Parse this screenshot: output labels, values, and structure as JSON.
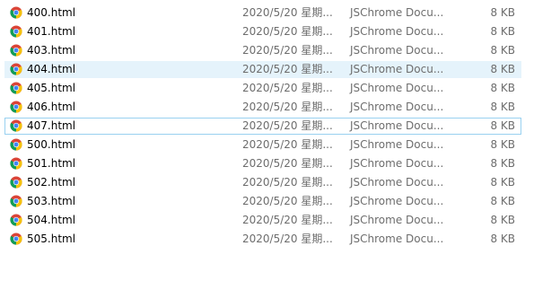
{
  "files": [
    {
      "name": "400.html",
      "date": "2020/5/20 星期...",
      "type": "JSChrome Docu...",
      "size": "8 KB",
      "icon": "chrome-icon"
    },
    {
      "name": "401.html",
      "date": "2020/5/20 星期...",
      "type": "JSChrome Docu...",
      "size": "8 KB",
      "icon": "chrome-icon"
    },
    {
      "name": "403.html",
      "date": "2020/5/20 星期...",
      "type": "JSChrome Docu...",
      "size": "8 KB",
      "icon": "chrome-icon"
    },
    {
      "name": "404.html",
      "date": "2020/5/20 星期...",
      "type": "JSChrome Docu...",
      "size": "8 KB",
      "icon": "chrome-icon",
      "state": "hover"
    },
    {
      "name": "405.html",
      "date": "2020/5/20 星期...",
      "type": "JSChrome Docu...",
      "size": "8 KB",
      "icon": "chrome-icon"
    },
    {
      "name": "406.html",
      "date": "2020/5/20 星期...",
      "type": "JSChrome Docu...",
      "size": "8 KB",
      "icon": "chrome-icon"
    },
    {
      "name": "407.html",
      "date": "2020/5/20 星期...",
      "type": "JSChrome Docu...",
      "size": "8 KB",
      "icon": "chrome-icon",
      "state": "focused"
    },
    {
      "name": "500.html",
      "date": "2020/5/20 星期...",
      "type": "JSChrome Docu...",
      "size": "8 KB",
      "icon": "chrome-icon"
    },
    {
      "name": "501.html",
      "date": "2020/5/20 星期...",
      "type": "JSChrome Docu...",
      "size": "8 KB",
      "icon": "chrome-icon"
    },
    {
      "name": "502.html",
      "date": "2020/5/20 星期...",
      "type": "JSChrome Docu...",
      "size": "8 KB",
      "icon": "chrome-icon"
    },
    {
      "name": "503.html",
      "date": "2020/5/20 星期...",
      "type": "JSChrome Docu...",
      "size": "8 KB",
      "icon": "chrome-icon"
    },
    {
      "name": "504.html",
      "date": "2020/5/20 星期...",
      "type": "JSChrome Docu...",
      "size": "8 KB",
      "icon": "chrome-icon"
    },
    {
      "name": "505.html",
      "date": "2020/5/20 星期...",
      "type": "JSChrome Docu...",
      "size": "8 KB",
      "icon": "chrome-icon"
    }
  ],
  "colors": {
    "hover_bg": "#e5f3fb",
    "focus_border": "#99d1f0",
    "secondary_text": "#6d6d6d"
  }
}
